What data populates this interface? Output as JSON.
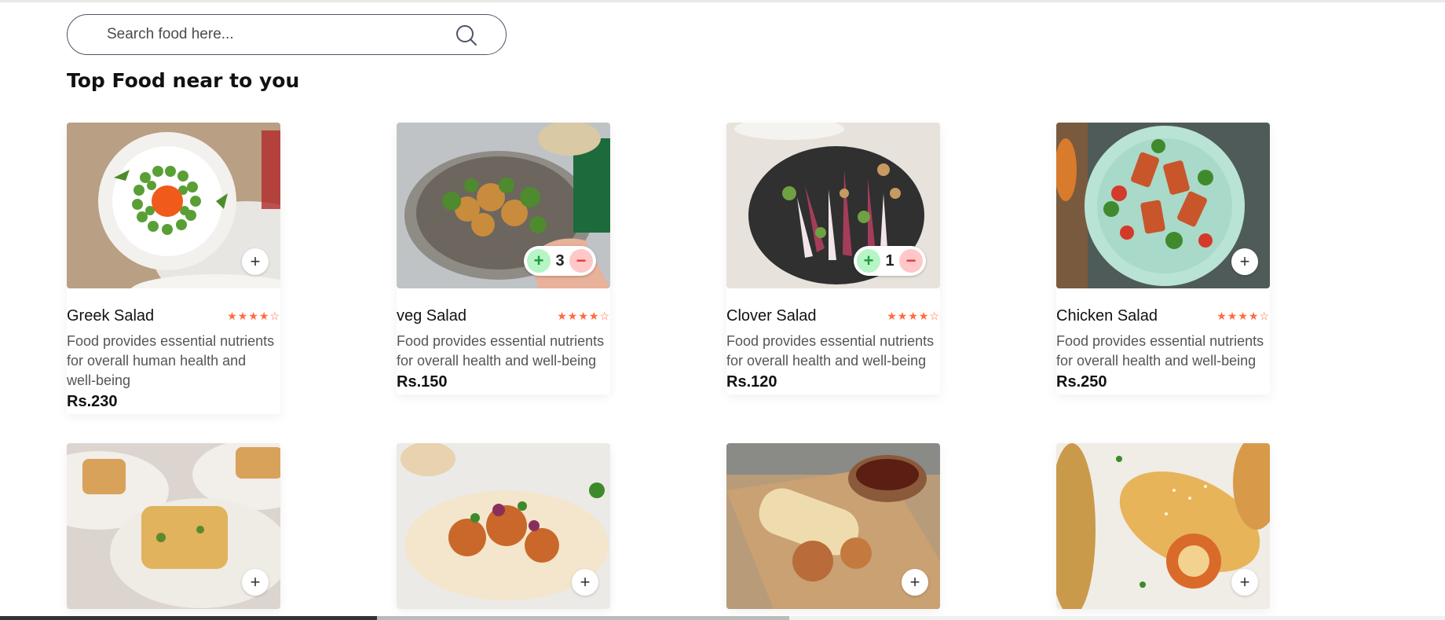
{
  "search": {
    "placeholder": "Search food here..."
  },
  "section_title": "Top Food near to you",
  "colors": {
    "accent": "#ff6a3d",
    "plus_bg": "#b6f5c6",
    "minus_bg": "#ffc7c7"
  },
  "foods": [
    {
      "name": "Greek Salad",
      "rating": 4,
      "stars": "★★★★☆",
      "description": "Food provides essential nutrients for overall human health and well-being",
      "price": "Rs.230",
      "add": "+"
    },
    {
      "name": "veg Salad",
      "rating": 4,
      "stars": "★★★★☆",
      "description": "Food provides essential nutrients for overall health and well-being",
      "price": "Rs.150",
      "qty": "3",
      "plus": "+",
      "minus": "−"
    },
    {
      "name": "Clover Salad",
      "rating": 4,
      "stars": "★★★★☆",
      "description": "Food provides essential nutrients for overall health and well-being",
      "price": "Rs.120",
      "qty": "1",
      "plus": "+",
      "minus": "−"
    },
    {
      "name": "Chicken Salad",
      "rating": 4,
      "stars": "★★★★☆",
      "description": "Food provides essential nutrients for overall health and well-being",
      "price": "Rs.250",
      "add": "+"
    },
    {
      "add": "+"
    },
    {
      "add": "+"
    },
    {
      "add": "+"
    },
    {
      "add": "+"
    }
  ]
}
